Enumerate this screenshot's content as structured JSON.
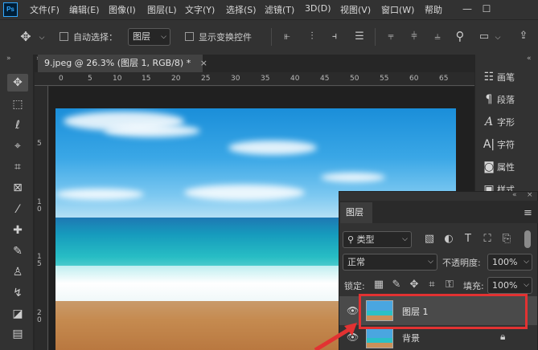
{
  "app": {
    "logo": "Ps"
  },
  "menu": [
    "文件(F)",
    "编辑(E)",
    "图像(I)",
    "图层(L)",
    "文字(Y)",
    "选择(S)",
    "滤镜(T)",
    "3D(D)",
    "视图(V)",
    "窗口(W)",
    "帮助"
  ],
  "window_controls": {
    "minimize": "—",
    "restore": "☐"
  },
  "options_bar": {
    "auto_select_label": "自动选择：",
    "auto_select_value": "图层",
    "show_transform_label": "显示变换控件"
  },
  "document": {
    "tab_title": "9.jpeg @ 26.3% (图层 1, RGB/8) *",
    "close": "×",
    "ruler_numbers": [
      "0",
      "5",
      "10",
      "15",
      "20",
      "25",
      "30",
      "35",
      "40",
      "45",
      "50",
      "55",
      "60",
      "65"
    ],
    "vruler_numbers": [
      "5",
      "10",
      "15",
      "20"
    ]
  },
  "right_panel": {
    "items": [
      {
        "icon": "brush-icon",
        "label": "画笔"
      },
      {
        "icon": "paragraph-icon",
        "label": "段落"
      },
      {
        "icon": "character-icon",
        "label": "字形"
      },
      {
        "icon": "glyph-icon",
        "label": "字符"
      },
      {
        "icon": "properties-icon",
        "label": "属性"
      },
      {
        "icon": "styles-icon",
        "label": "样式"
      }
    ]
  },
  "layers_panel": {
    "tab_label": "图层",
    "filter_kind": "类型",
    "blend_mode": "正常",
    "opacity_label": "不透明度:",
    "opacity_value": "100%",
    "lock_label": "锁定:",
    "fill_label": "填充:",
    "fill_value": "100%",
    "layers": [
      {
        "name": "图层 1",
        "selected": true,
        "visible": true,
        "locked": false
      },
      {
        "name": "背景",
        "selected": false,
        "visible": true,
        "locked": true
      }
    ]
  },
  "colors": {
    "accent": "#e23232",
    "panel": "#323232",
    "selected_layer": "#4a4a4a"
  }
}
